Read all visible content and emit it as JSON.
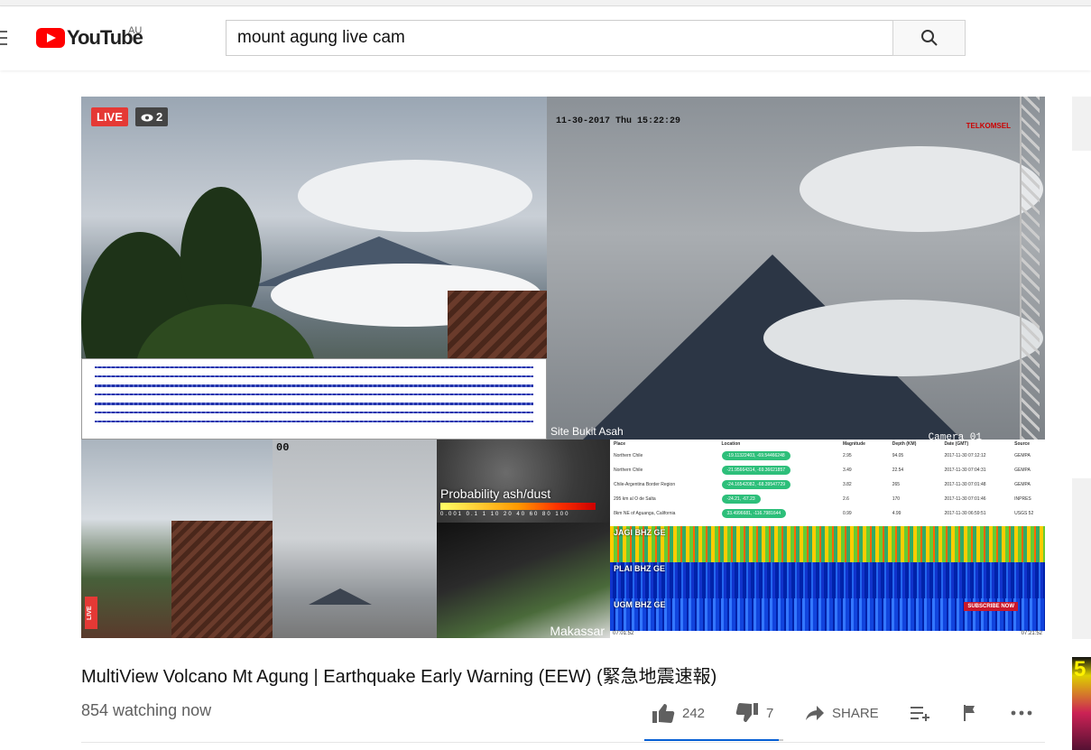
{
  "header": {
    "logo_text": "YouTube",
    "region": "AU",
    "search_value": "mount agung live cam"
  },
  "player": {
    "live_badge": "LIVE",
    "viewer_count": "2",
    "cam_timestamp": "11-30-2017 Thu 15:22:29",
    "telkomsel": "TELKOMSEL",
    "site_label": "Site Bukit Asah",
    "camera_label": "Camera 01",
    "cam_number": "00",
    "ash_label": "Probability ash/dust",
    "ash_ticks": "0.001 0.1 1 10 20 40 60 80 100",
    "makassar_label": "Makassar",
    "side_live": "LIVE",
    "quake_table": {
      "headers": [
        "Place",
        "Location",
        "Magnitude",
        "Depth (KM)",
        "Date (GMT)",
        "Source"
      ],
      "rows": [
        [
          "Northern Chile",
          "-19.11322403, -69.54466248",
          "2.95",
          "94.05",
          "2017-11-30 07:12:12",
          "GEMPA"
        ],
        [
          "Northern Chile",
          "-21.95664314, -69.36621857",
          "3.49",
          "22.54",
          "2017-11-30 07:04:31",
          "GEMPA"
        ],
        [
          "Chile-Argentina Border Region",
          "-24.16542082, -68.39547729",
          "3.82",
          "265",
          "2017-11-30 07:01:48",
          "GEMPA"
        ],
        [
          "295 km al O de Salta",
          "-24.21, -67.23",
          "2.6",
          "170",
          "2017-11-30 07:01:46",
          "INPRES"
        ],
        [
          "8km NE of Aguanga, California",
          "33.4996681, -116.7981644",
          "0.99",
          "4.99",
          "2017-11-30 06:59:51",
          "USGS 52"
        ]
      ]
    },
    "spectrograms": [
      "JAGI BHZ GE",
      "PLAI BHZ GE",
      "UGM BHZ GE"
    ],
    "spec_start": "07:01:52",
    "spec_end": "07:21:52",
    "subscribe_now": "SUBSCRIBE NOW"
  },
  "video": {
    "title": "MultiView Volcano Mt Agung | Earthquake Early Warning (EEW) (緊急地震速報)",
    "watching": "854 watching now",
    "likes": "242",
    "dislikes": "7",
    "share_label": "SHARE",
    "like_ratio": 0.97
  },
  "colors": {
    "brand_red": "#ff0000",
    "accent_blue": "#065fd4",
    "live_red": "#e53935"
  }
}
